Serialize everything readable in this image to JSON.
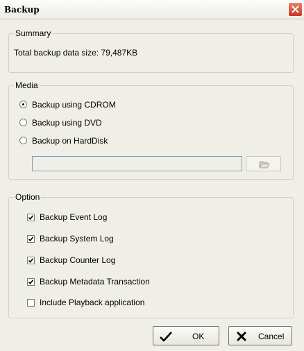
{
  "window": {
    "title": "Backup",
    "close_icon": "close-icon"
  },
  "summary": {
    "legend": "Summary",
    "total_text": "Total backup data size: 79,487KB"
  },
  "media": {
    "legend": "Media",
    "options": [
      {
        "label": "Backup using CDROM",
        "selected": true
      },
      {
        "label": "Backup using DVD",
        "selected": false
      },
      {
        "label": "Backup on HardDisk",
        "selected": false
      }
    ],
    "path_value": "",
    "browse_icon": "folder-open-icon"
  },
  "option": {
    "legend": "Option",
    "items": [
      {
        "label": "Backup Event Log",
        "checked": true
      },
      {
        "label": "Backup System Log",
        "checked": true
      },
      {
        "label": "Backup Counter Log",
        "checked": true
      },
      {
        "label": "Backup Metadata Transaction",
        "checked": true
      },
      {
        "label": "Include Playback application",
        "checked": false
      }
    ]
  },
  "buttons": {
    "ok_label": "OK",
    "ok_icon": "checkmark-icon",
    "cancel_label": "Cancel",
    "cancel_icon": "x-icon"
  }
}
